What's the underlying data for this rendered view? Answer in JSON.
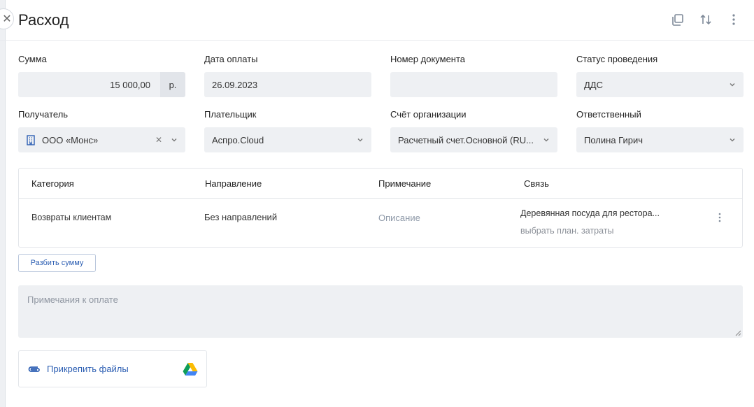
{
  "header": {
    "title": "Расход",
    "icons": [
      "copy-icon",
      "sort-arrows-icon",
      "more-vertical-icon"
    ]
  },
  "fields": {
    "amount": {
      "label": "Сумма",
      "value": "15 000,00",
      "unit": "р."
    },
    "pay_date": {
      "label": "Дата оплаты",
      "value": "26.09.2023"
    },
    "doc_number": {
      "label": "Номер документа",
      "value": ""
    },
    "status": {
      "label": "Статус проведения",
      "value": "ДДС"
    },
    "recipient": {
      "label": "Получатель",
      "value": "ООО «Монс»"
    },
    "payer": {
      "label": "Плательщик",
      "value": "Аспро.Cloud"
    },
    "account": {
      "label": "Счёт организации",
      "value": "Расчетный счет.Основной (RU..."
    },
    "responsible": {
      "label": "Ответственный",
      "value": "Полина Гирич"
    }
  },
  "table": {
    "headers": [
      "Категория",
      "Направление",
      "Примечание",
      "Связь"
    ],
    "row": {
      "category": "Возвраты клиентам",
      "direction": "Без направлений",
      "note_placeholder": "Описание",
      "link": "Деревянная посуда для рестора...",
      "link_sub": "выбрать план. затраты"
    }
  },
  "split_button": "Разбить сумму",
  "notes_placeholder": "Примечания к оплате",
  "attach_label": "Прикрепить файлы"
}
